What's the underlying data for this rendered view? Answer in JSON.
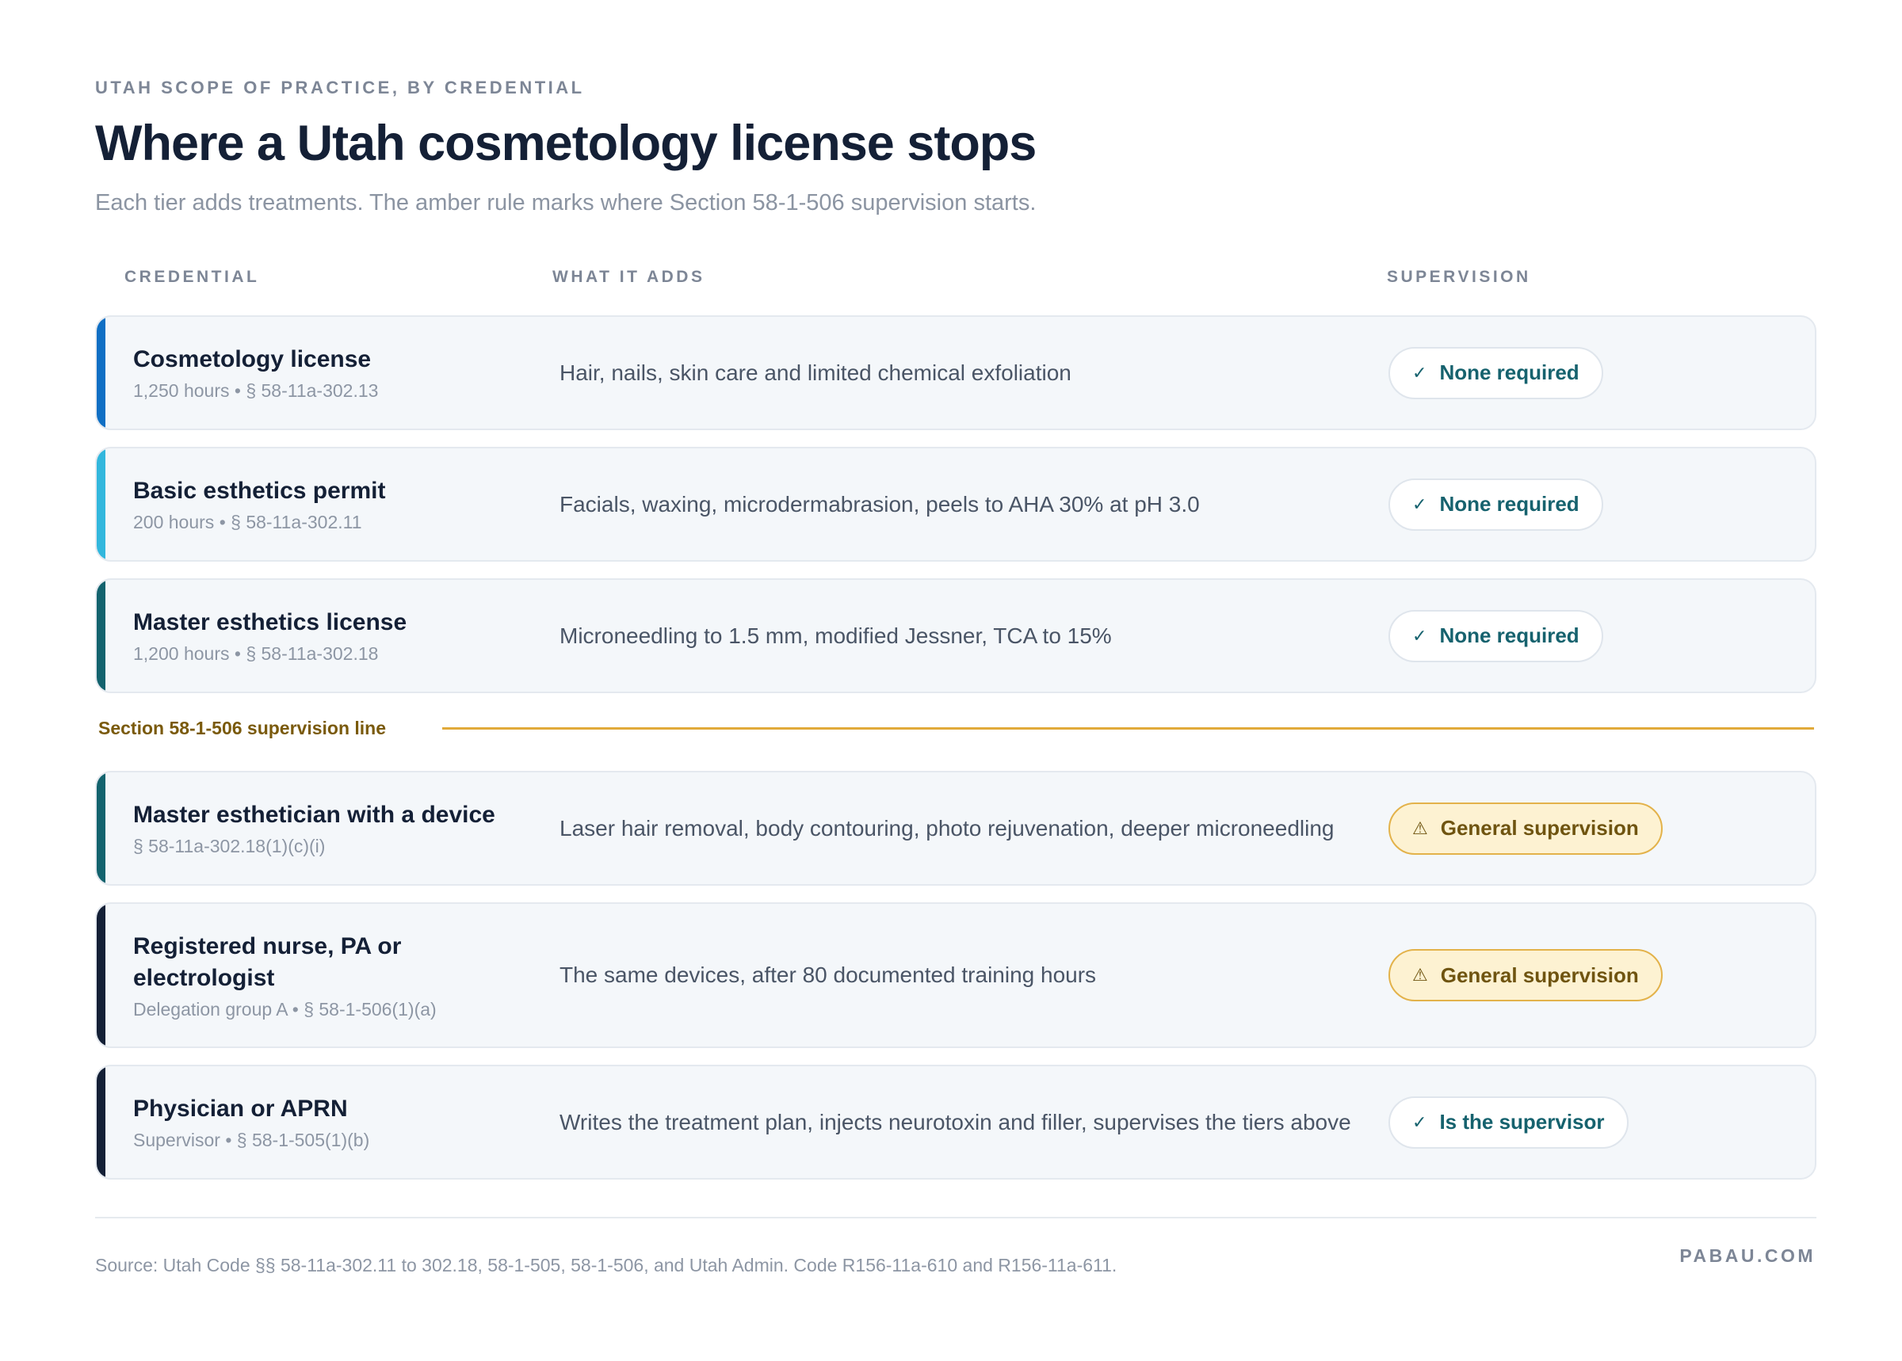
{
  "header": {
    "eyebrow": "UTAH SCOPE OF PRACTICE, BY CREDENTIAL",
    "title": "Where a Utah cosmetology license stops",
    "subtitle": "Each tier adds treatments. The amber rule marks where Section 58-1-506 supervision starts."
  },
  "columns": {
    "credential": "CREDENTIAL",
    "adds": "WHAT IT ADDS",
    "supervision": "SUPERVISION"
  },
  "colors": {
    "accent_blue": "#0f6fc4",
    "accent_cyan": "#32b7dd",
    "accent_teal": "#13636e",
    "accent_navy": "#142036",
    "amber": "#e1aa3a"
  },
  "rows": [
    {
      "name": "Cosmetology license",
      "meta": "1,250 hours • § 58-11a-302.13",
      "adds": "Hair, nails, skin care and limited chemical exfoliation",
      "supervision": "None required",
      "status": "ok",
      "status_icon": "check-icon",
      "accent": "#0f6fc4"
    },
    {
      "name": "Basic esthetics permit",
      "meta": "200 hours • § 58-11a-302.11",
      "adds": "Facials, waxing, microdermabrasion, peels to AHA 30% at pH 3.0",
      "supervision": "None required",
      "status": "ok",
      "status_icon": "check-icon",
      "accent": "#32b7dd"
    },
    {
      "name": "Master esthetics license",
      "meta": "1,200 hours • § 58-11a-302.18",
      "adds": "Microneedling to 1.5 mm, modified Jessner, TCA to 15%",
      "supervision": "None required",
      "status": "ok",
      "status_icon": "check-icon",
      "accent": "#13636e"
    },
    {
      "name": "Master esthetician with a device",
      "meta": "§ 58-11a-302.18(1)(c)(i)",
      "adds": "Laser hair removal, body contouring, photo rejuvenation, deeper microneedling",
      "supervision": "General supervision",
      "status": "warn",
      "status_icon": "warning-icon",
      "accent": "#13636e"
    },
    {
      "name": "Registered nurse, PA or electrologist",
      "meta": "Delegation group A • § 58-1-506(1)(a)",
      "adds": "The same devices, after 80 documented training hours",
      "supervision": "General supervision",
      "status": "warn",
      "status_icon": "warning-icon",
      "accent": "#142036"
    },
    {
      "name": "Physician or APRN",
      "meta": "Supervisor • § 58-1-505(1)(b)",
      "adds": "Writes the treatment plan, injects neurotoxin and filler, supervises the tiers above",
      "supervision": "Is the supervisor",
      "status": "ok",
      "status_icon": "check-icon",
      "accent": "#142036"
    }
  ],
  "divider": {
    "label": "Section 58-1-506 supervision line"
  },
  "footer": {
    "source": "Source: Utah Code §§ 58-11a-302.11 to 302.18, 58-1-505, 58-1-506, and Utah Admin. Code R156-11a-610 and R156-11a-611.",
    "brand": "PABAU.COM"
  }
}
